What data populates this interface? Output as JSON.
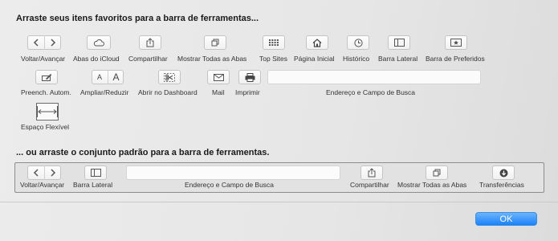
{
  "heading_top": "Arraste seus itens favoritos para a barra de ferramentas...",
  "heading_default": "... ou arraste o conjunto padrão para a barra de ferramentas.",
  "items": {
    "back_forward": "Voltar/Avançar",
    "icloud_tabs": "Abas do iCloud",
    "share": "Compartilhar",
    "show_all_tabs": "Mostrar Todas as Abas",
    "top_sites": "Top Sites",
    "home": "Página Inicial",
    "history": "Histórico",
    "sidebar": "Barra Lateral",
    "favorites_bar": "Barra de Preferidos",
    "autofill": "Preench. Autom.",
    "zoom": "Ampliar/Reduzir",
    "dashboard": "Abrir no Dashboard",
    "mail": "Mail",
    "print": "Imprimir",
    "address_search": "Endereço e Campo de Busca",
    "flexible_space": "Espaço Flexível",
    "zoom_small": "A",
    "zoom_large": "A"
  },
  "default_set": {
    "back_forward": "Voltar/Avançar",
    "sidebar": "Barra Lateral",
    "address_search": "Endereço e Campo de Busca",
    "share": "Compartilhar",
    "show_all_tabs": "Mostrar Todas as Abas",
    "downloads": "Transferências"
  },
  "ok_button": "OK",
  "colors": {
    "accent": "#1a82fb",
    "background": "#e6e6e6"
  }
}
